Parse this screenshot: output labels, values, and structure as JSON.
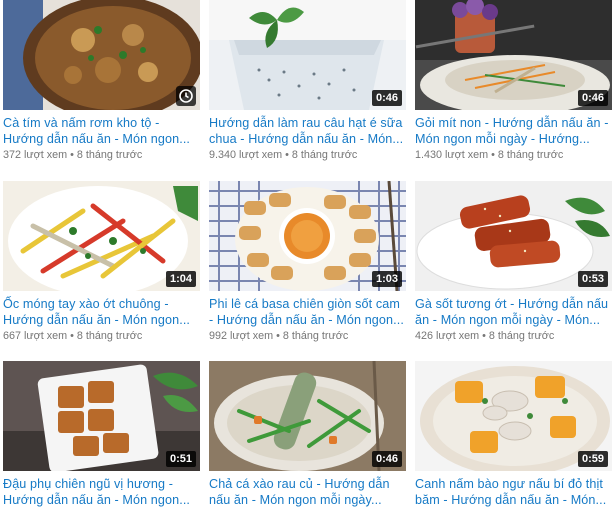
{
  "videos": [
    {
      "title": "Cà tím và nấm rơm kho tộ - Hướng dẫn nấu ăn - Món ngon...",
      "views": "372 lượt xem",
      "age": "8 tháng trước",
      "duration": "",
      "thumb_icon": "clock-icon",
      "colors": [
        "#5f3b1f",
        "#c99a55",
        "#2d7a2a"
      ]
    },
    {
      "title": "Hướng dẫn làm rau câu hạt é sữa chua - Hướng dẫn nấu ăn - Món...",
      "views": "9.340 lượt xem",
      "age": "8 tháng trước",
      "duration": "0:46",
      "thumb_icon": "",
      "colors": [
        "#e8eef2",
        "#f4f6f8",
        "#3f8a3a"
      ]
    },
    {
      "title": "Gỏi mít non - Hướng dẫn nấu ăn - Món ngon mỗi ngày - Hướng...",
      "views": "1.430 lượt xem",
      "age": "8 tháng trước",
      "duration": "0:46",
      "thumb_icon": "",
      "colors": [
        "#3a3a3a",
        "#d8d2c4",
        "#7a4a9a"
      ]
    },
    {
      "title": "Ốc móng tay xào ớt chuông - Hướng dẫn nấu ăn - Món ngon...",
      "views": "667 lượt xem",
      "age": "8 tháng trước",
      "duration": "1:04",
      "thumb_icon": "",
      "colors": [
        "#f0ead8",
        "#e8c638",
        "#d63a2a"
      ]
    },
    {
      "title": "Phi lê cá basa chiên giòn sốt cam - Hướng dẫn nấu ăn - Món ngon...",
      "views": "992 lượt xem",
      "age": "8 tháng trước",
      "duration": "1:03",
      "thumb_icon": "",
      "colors": [
        "#7a86b0",
        "#d9a25a",
        "#e88a2a"
      ]
    },
    {
      "title": "Gà sốt tương ớt - Hướng dẫn nấu ăn - Món ngon mỗi ngày - Món...",
      "views": "426 lượt xem",
      "age": "8 tháng trước",
      "duration": "0:53",
      "thumb_icon": "",
      "colors": [
        "#eeeeee",
        "#b8401e",
        "#3f8a3a"
      ]
    },
    {
      "title": "Đậu phụ chiên ngũ vị hương - Hướng dẫn nấu ăn - Món ngon...",
      "views": "",
      "age": "",
      "duration": "0:51",
      "thumb_icon": "",
      "colors": [
        "#7a6c6a",
        "#b86a2a",
        "#3f8a3a"
      ]
    },
    {
      "title": "Chả cá xào rau củ - Hướng dẫn nấu ăn - Món ngon mỗi ngày...",
      "views": "",
      "age": "",
      "duration": "0:46",
      "thumb_icon": "",
      "colors": [
        "#8c7a64",
        "#8aa07a",
        "#3f9a3a"
      ]
    },
    {
      "title": "Canh nấm bào ngư nấu bí đỏ thịt băm - Hướng dẫn nấu ăn - Món...",
      "views": "",
      "age": "",
      "duration": "0:59",
      "thumb_icon": "",
      "colors": [
        "#f2f2f2",
        "#f0a22a",
        "#e8e0d4"
      ]
    }
  ],
  "separator": "•"
}
